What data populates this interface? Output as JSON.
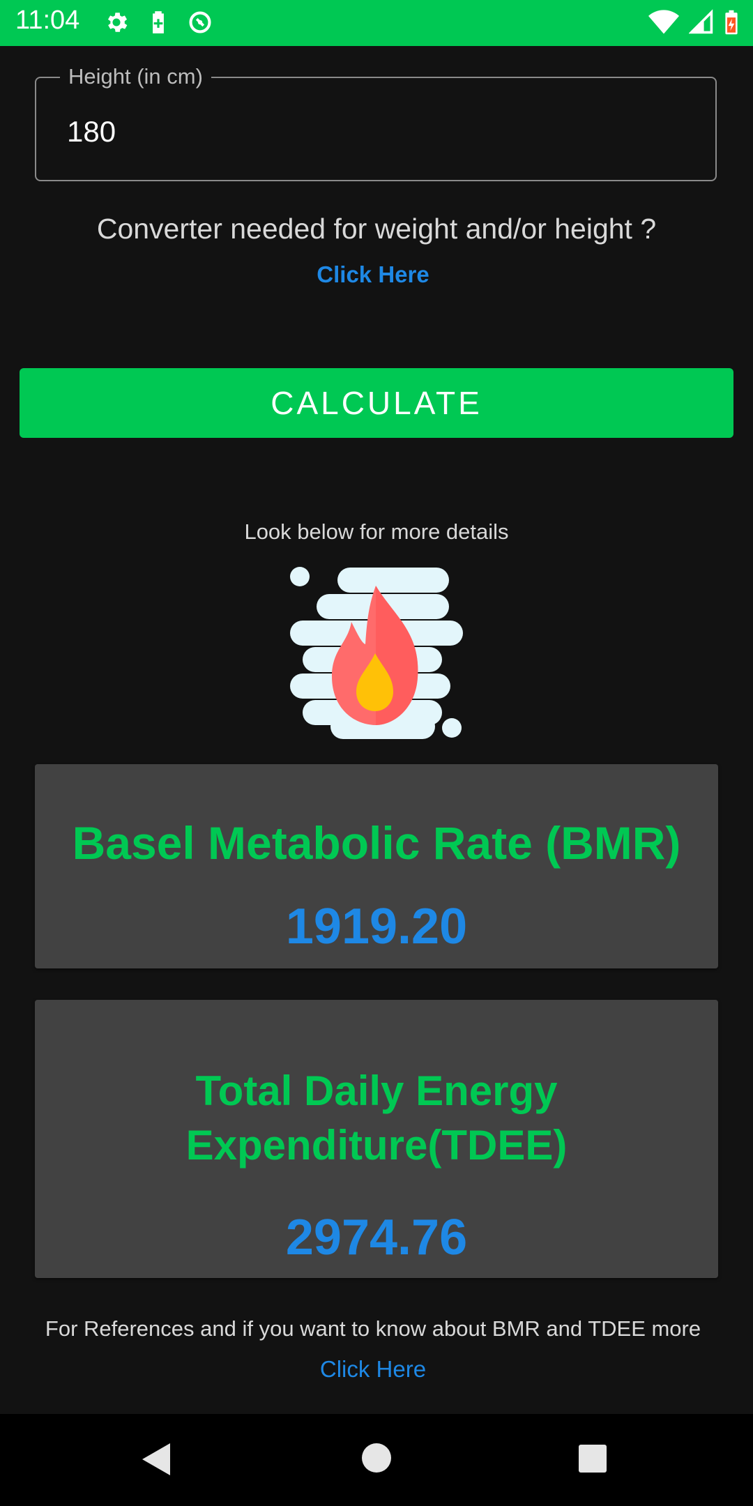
{
  "status_bar": {
    "time": "11:04",
    "left_icons": [
      "gear-icon",
      "battery-saver-icon",
      "data-saver-icon"
    ],
    "right_icons": [
      "wifi-icon",
      "signal-icon",
      "battery-icon"
    ],
    "background_color": "#00c853"
  },
  "height_field": {
    "label": "Height (in cm)",
    "value": "180"
  },
  "converter": {
    "question": "Converter needed for weight and/or height ?",
    "link": "Click Here"
  },
  "calculate_button": {
    "label": "CALCULATE",
    "color": "#00c853"
  },
  "details_hint": "Look below for more details",
  "illustration": "fire-icon",
  "bmr_card": {
    "title": "Basel Metabolic Rate (BMR)",
    "value": "1919.20"
  },
  "tdee_card": {
    "title_line1": "Total Daily Energy",
    "title_line2": "Expenditure(TDEE)",
    "value": "2974.76"
  },
  "references": {
    "text": "For References and if you want to know about BMR and TDEE more",
    "link": "Click Here"
  },
  "colors": {
    "accent_green": "#00c853",
    "link_blue": "#1e88e5",
    "card_bg": "#424242",
    "page_bg": "#121212"
  },
  "nav_bar": {
    "buttons": [
      "back-icon",
      "home-icon",
      "recents-icon"
    ]
  }
}
